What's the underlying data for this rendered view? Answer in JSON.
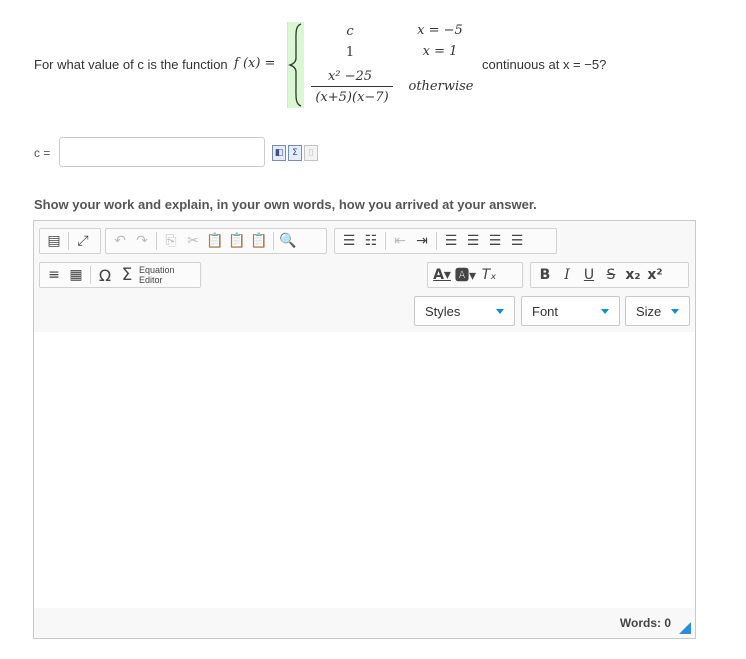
{
  "question": {
    "prefix": "For what value of c is the function",
    "fx": "f (x) =",
    "suffix": "continuous at x = −5?",
    "cases": [
      {
        "expr": "c",
        "cond": "x = −5"
      },
      {
        "expr": "1",
        "cond": "x = 1"
      },
      {
        "num": "x² −25",
        "den": "(x+5)(x−7)",
        "cond": "otherwise"
      }
    ]
  },
  "answer": {
    "label": "c =",
    "value": "",
    "placeholder": "",
    "icons": [
      "preview-icon",
      "equation-icon",
      "copy-icon"
    ]
  },
  "work": {
    "label": "Show your work and explain, in your own words, how you arrived at your answer."
  },
  "editor": {
    "eq_editor_label_1": "Equation",
    "eq_editor_label_2": "Editor",
    "styles_label": "Styles",
    "font_label": "Font",
    "size_label": "Size",
    "words_label": "Words: 0",
    "bold": "B",
    "italic": "I",
    "underline": "U",
    "strike": "S"
  }
}
